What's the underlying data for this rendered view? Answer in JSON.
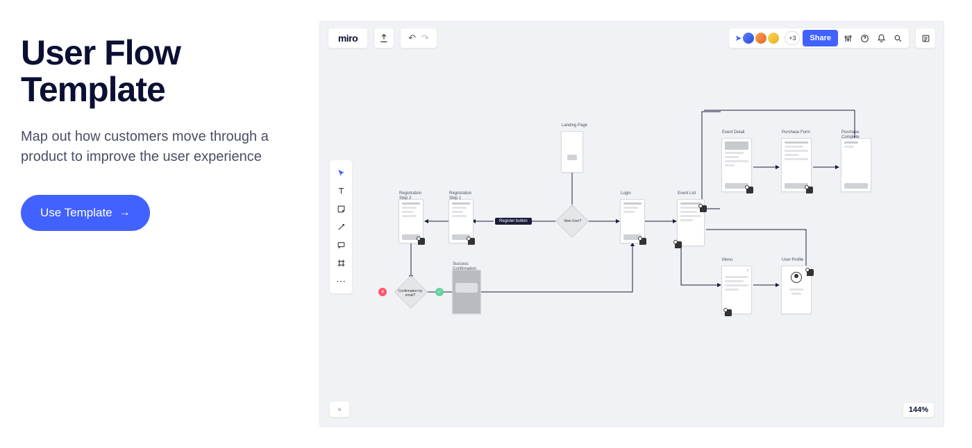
{
  "left": {
    "title": "User Flow Template",
    "subtitle": "Map out how customers move through a product to improve the user experience",
    "cta_label": "Use Template",
    "cta_arrow": "→"
  },
  "miro": {
    "logo": "miro",
    "avatars_more": "+3",
    "share": "Share",
    "zoom": "144%",
    "diagram": {
      "nodes": {
        "landing_page": "Landing Page",
        "reg_step2": "Registration\nStep 2",
        "reg_step1": "Registration\nStep 1",
        "new_user": "New\nUser?",
        "login": "Login",
        "event_list": "Event List",
        "event_detail": "Event Detail",
        "purchase_form": "Purchase Form",
        "purchase_complete": "Purchase\nComplete",
        "menu": "Menu",
        "user_profile": "User Profile",
        "success_conf": "Success\nConfirmation",
        "conf_email": "Confirmation\nby email?",
        "register_button": "Register button"
      }
    }
  }
}
